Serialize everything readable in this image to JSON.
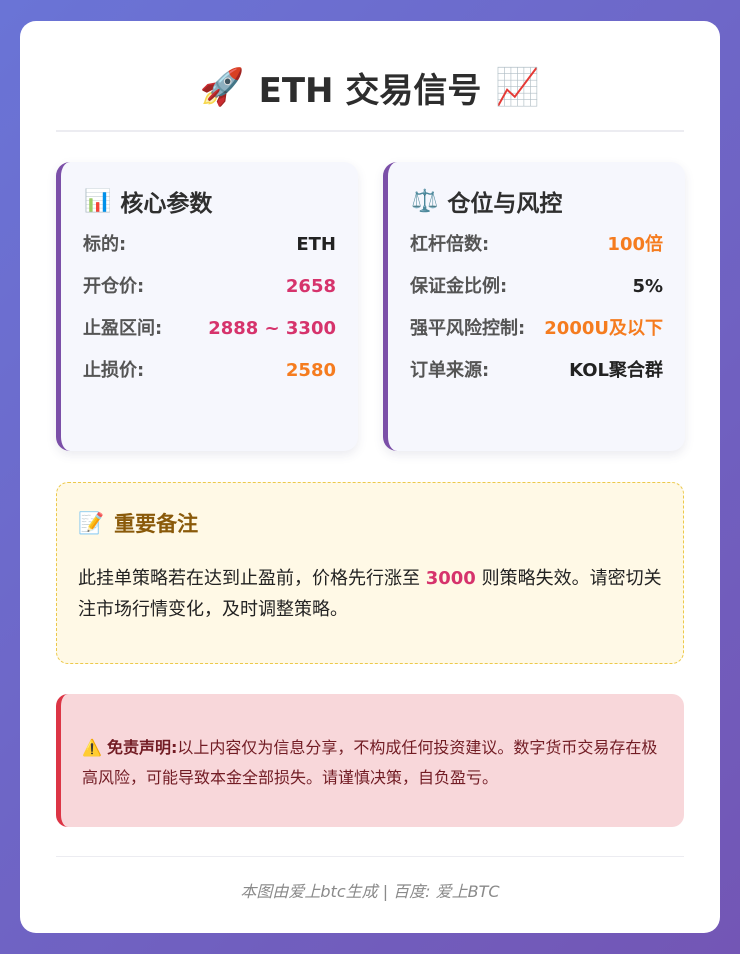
{
  "header": {
    "title": "ETH 交易信号",
    "icon_left": "rocket-icon",
    "icon_right": "chart-up-icon",
    "emoji_left": "🚀",
    "emoji_right": "📈"
  },
  "core": {
    "icon": "bar-chart-icon",
    "emoji": "📊",
    "title": "核心参数",
    "rows": [
      {
        "label": "标的:",
        "value": "ETH"
      },
      {
        "label": "开仓价:",
        "value": "2658"
      },
      {
        "label": "止盈区间:",
        "value": "2888 ~ 3300"
      },
      {
        "label": "止损价:",
        "value": "2580"
      }
    ]
  },
  "risk": {
    "icon": "scales-icon",
    "emoji": "⚖️",
    "title": "仓位与风控",
    "rows": [
      {
        "label": "杠杆倍数:",
        "value": "100倍"
      },
      {
        "label": "保证金比例:",
        "value": "5%"
      },
      {
        "label": "强平风险控制:",
        "value": "2000U及以下"
      },
      {
        "label": "订单来源:",
        "value": "KOL聚合群"
      }
    ]
  },
  "note": {
    "icon": "memo-icon",
    "emoji": "📝",
    "title": "重要备注",
    "text_before": "此挂单策略若在达到止盈前，价格先行涨至 ",
    "highlight": "3000",
    "text_after": " 则策略失效。请密切关注市场行情变化，及时调整策略。"
  },
  "disclaimer": {
    "icon": "warning-icon",
    "emoji": "⚠️",
    "label": "免责声明:",
    "text": "以上内容仅为信息分享，不构成任何投资建议。数字货币交易存在极高风险，可能导致本金全部损失。请谨慎决策，自负盈亏。"
  },
  "footer": {
    "text": "本图由爱上btc生成 | 百度: 爱上BTC"
  },
  "colors": {
    "background_start": "#6a74d6",
    "background_end": "#7356b5",
    "panel_accent": "#7b4fa8",
    "pink": "#d6336c",
    "orange": "#f57c1f",
    "note_bg": "#fff9e6",
    "disclaimer_bg": "#f8d7da",
    "disclaimer_accent": "#dc3545"
  }
}
